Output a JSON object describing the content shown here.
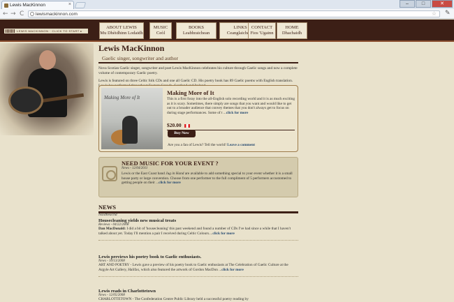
{
  "browser": {
    "tab_title": "Lewis MacKinnon",
    "url": "lewismackinnon.com",
    "tab_close": "×",
    "back": "←",
    "forward": "→",
    "reload": "C",
    "bookmark": "☆",
    "menu": "✎",
    "win_min": "–",
    "win_max": "□",
    "win_close": "✕"
  },
  "header": {
    "logo_text": "LEWIS MACKINNON · CLICK TO START ▸",
    "menu": [
      {
        "line1": "ABOUT LEWIS",
        "line2": "Mu Dhèidhinn Lodaidh"
      },
      {
        "line1": "MUSIC",
        "line2": "Ceòl"
      },
      {
        "line1": "BOOKS",
        "line2": "Leabhraichean"
      },
      {
        "line1": "LINKS",
        "line2": "Ceanglaichean"
      },
      {
        "line1": "CONTACT",
        "line2": "Fios 'Ugainn"
      },
      {
        "line1": "HOME",
        "line2": "Dhachaidh"
      }
    ]
  },
  "intro": {
    "name": "Lewis MacKinnon",
    "subtitle": "Gaelic singer, songwriter and author",
    "p1": "Nova Scotian Gaelic singer, songwriter and poet Lewis MacKinnon celebrates his culture through Gaelic songs and now a complete volume of contemporary Gaelic poetry.",
    "p2": "Lewis is featured on three Celtic folk CDs and one all Gaelic CD. His poetry book has 89 Gaelic poems with English translation. Lewis has performed throughout Eastern Canada, Scotland and Ireland."
  },
  "album": {
    "cover_text": "Making More of It",
    "title": "Making More of It",
    "desc": "This is a first foray into the all-English solo recording world and it is as much exciting as it is scary. Sometimes, there simply are songs that you want and would like to get out to a broader audience that convey themes that you don't always get to focus on during stage performances. Some of t ...",
    "more": "click for more",
    "price": "$20.00",
    "buy": "Buy Now",
    "fan_text": "Are you a fan of Lewis? Tell the world!",
    "comment": "Leave a comment"
  },
  "event": {
    "title": "NEED MUSIC FOR YOUR EVENT ?",
    "date": "News - 12/04/2011",
    "body_pre": "Lewis or the East Coast band ",
    "body_em": "Jug in Hand",
    "body_post": " are available to add something special to your event whether it is a small house party or large convention. Choose from one performer to the full compliment of 5 performers accustomed to getting people on their ...",
    "more": "click for more"
  },
  "news": {
    "heading": "NEWS",
    "gaelic": "Naidheachd",
    "items": [
      {
        "title": "Housecleaning yields new musical treats",
        "date": "Reviews - 04/22/2008",
        "author": "Dan MacDonald:",
        "body": " I did a bit of 'housecleaning' this past weekend and found a number of CDs I've had since a while that I haven't talked about yet. Today I'll mention a pair I received during Celtic Colours....",
        "more": "click for more"
      },
      {
        "title": "Lewis previews his poetry book to Gaelic enthusiasts.",
        "date": "News - 10/13/2008",
        "body": "ART AND POETRY - Lewis gave a preview of his poetry book to Gaelic enthusiasts at The Celebration of Gaelic Culture at the Argyle Art Gallery, Halifax, which also featured the artwork of Gordon MacDon ...",
        "more": "click for more"
      },
      {
        "title": "Lewis reads in Charlottetown",
        "date": "News - 12/05/2008",
        "body": "CHARLOTTETOWN - The Confederation Centre Public Library held a successful poetry reading by"
      }
    ]
  }
}
